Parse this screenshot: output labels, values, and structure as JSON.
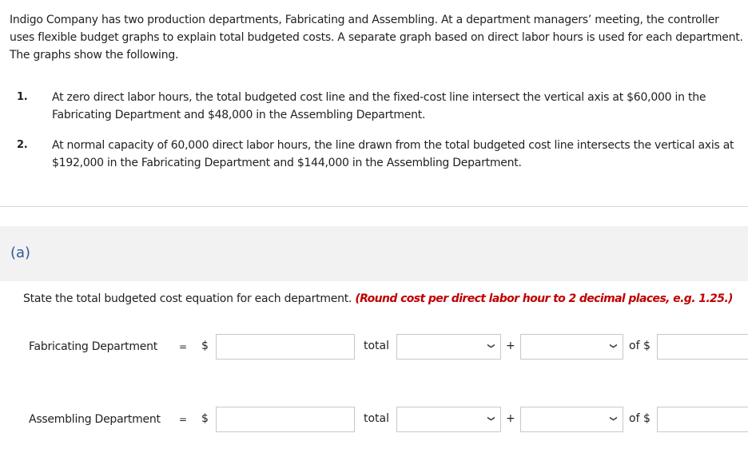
{
  "problem": {
    "intro": "Indigo Company has two production departments, Fabricating and Assembling. At a department managers’ meeting, the controller uses flexible budget graphs to explain total budgeted costs. A separate graph based on direct labor hours is used for each department. The graphs show the following.",
    "items": [
      {
        "number": "1.",
        "text": "At zero direct labor hours, the total budgeted cost line and the fixed-cost line intersect the vertical axis at $60,000 in the Fabricating Department and $48,000 in the Assembling Department."
      },
      {
        "number": "2.",
        "text": "At normal capacity of 60,000 direct labor hours, the line drawn from the total budgeted cost line intersects the vertical axis at $192,000 in the Fabricating Department and $144,000 in the Assembling Department."
      }
    ]
  },
  "part": {
    "label": "(a)",
    "instruction": "State the total budgeted cost equation for each department.",
    "hint": "(Round cost per direct labor hour to 2 decimal places, e.g. 1.25.)"
  },
  "equations": [
    {
      "department": "Fabricating Department",
      "equals": "=",
      "dollar_sign": "$",
      "amount_value": "",
      "total_label": "total",
      "select1_value": "",
      "plus": "+",
      "select2_value": "",
      "of_label": "of $",
      "rate_value": ""
    },
    {
      "department": "Assembling Department",
      "equals": "=",
      "dollar_sign": "$",
      "amount_value": "",
      "total_label": "total",
      "select1_value": "",
      "plus": "+",
      "select2_value": "",
      "of_label": "of $",
      "rate_value": ""
    }
  ],
  "icons": {
    "dropdown": "chevron-down-icon"
  },
  "colors": {
    "hint": "#c00000",
    "part_label": "#2a5a9a",
    "panel_bg": "#f2f2f2"
  }
}
